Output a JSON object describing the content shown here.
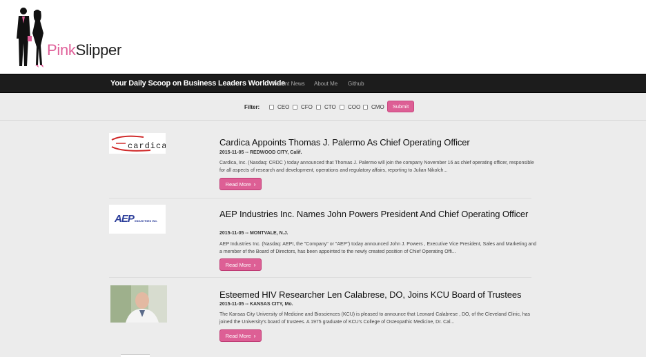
{
  "logo": {
    "text_part1": "Pink",
    "text_part2": "Slipper"
  },
  "nav": {
    "brand": "Your Daily Scoop on Business Leaders Worldwide",
    "links": [
      "Recent News",
      "About Me",
      "Github"
    ]
  },
  "filter": {
    "label": "Filter:",
    "options": [
      "CEO",
      "CFO",
      "CTO",
      "COO",
      "CMO"
    ],
    "submit_label": "Submit"
  },
  "articles": [
    {
      "title": "Cardica Appoints Thomas J. Palermo As Chief Operating Officer",
      "meta": "2015-11-05 -- REDWOOD CITY, Calif.",
      "summary": "Cardica, Inc. (Nasdaq: CRDC ) today announced that Thomas J. Palermo will join the company November 16 as chief operating officer, responsible for all aspects of research and development, operations and regulatory affairs, reporting to Julian Nikolch...",
      "read_more": "Read More",
      "logo_text": "cardica"
    },
    {
      "title": "AEP Industries Inc. Names John Powers President And Chief Operating Officer",
      "meta": "2015-11-05 -- MONTVALE, N.J.",
      "summary": "AEP Industries Inc. (Nasdaq: AEPI, the \"Company\" or \"AEP\") today announced John J. Powers , Executive Vice President, Sales and Marketing and a member of the Board of Directors, has been appointed to the newly created position of Chief Operating Offi...",
      "read_more": "Read More",
      "logo_text": "AEP",
      "logo_sub": "INDUSTRIES INC."
    },
    {
      "title": "Esteemed HIV Researcher Len Calabrese, DO, Joins KCU Board of Trustees",
      "meta": "2015-11-05 -- KANSAS CITY, Mo.",
      "summary": "The Kansas City University of Medicine and Biosciences (KCU) is pleased to announce that Leonard Calabrese , DO, of the Cleveland Clinic, has joined the University's board of trustees. A 1975 graduate of KCU's College of Osteopathic Medicine, Dr. Cal...",
      "read_more": "Read More"
    }
  ],
  "colors": {
    "accent": "#dd5f95",
    "navbar": "#1c1c1c",
    "background": "#ececec"
  },
  "icons": {
    "read_more": "chevron-right-icon"
  }
}
